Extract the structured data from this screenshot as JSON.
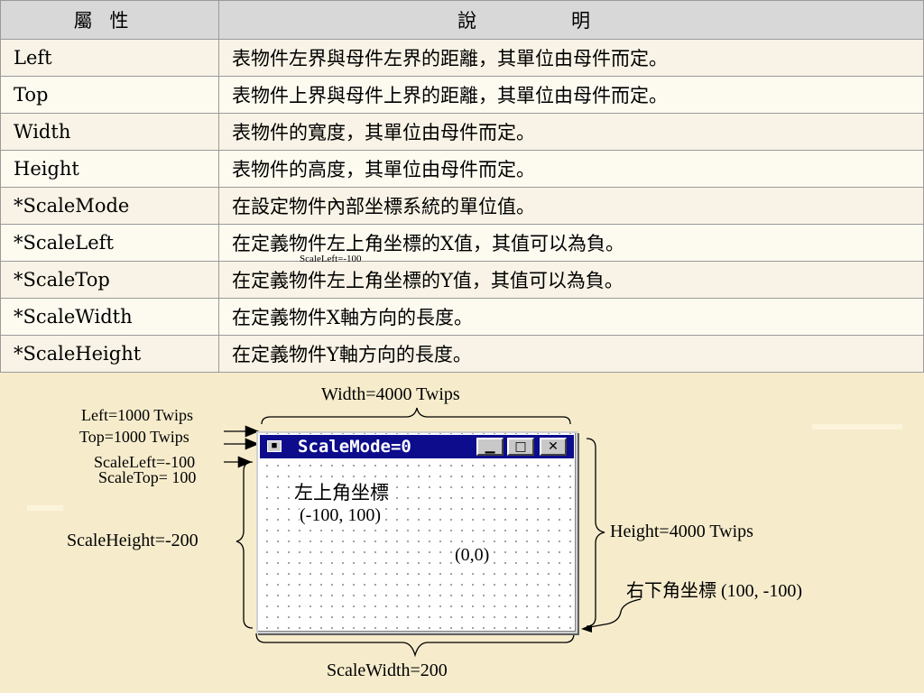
{
  "table": {
    "header_attr": "屬性",
    "header_desc": "說明",
    "rows": [
      {
        "attr": "Left",
        "desc": "表物件左界與母件左界的距離，其單位由母件而定。"
      },
      {
        "attr": "Top",
        "desc": "表物件上界與母件上界的距離，其單位由母件而定。"
      },
      {
        "attr": "Width",
        "desc": "表物件的寬度，其單位由母件而定。"
      },
      {
        "attr": "Height",
        "desc": "表物件的高度，其單位由母件而定。"
      },
      {
        "attr": "*ScaleMode",
        "desc": "在設定物件內部坐標系統的單位值。"
      },
      {
        "attr": "*ScaleLeft",
        "desc": "在定義物件左上角坐標的X值，其值可以為負。"
      },
      {
        "attr": "*ScaleTop",
        "desc": "在定義物件左上角坐標的Y值，其值可以為負。"
      },
      {
        "attr": "*ScaleWidth",
        "desc": "在定義物件X軸方向的長度。"
      },
      {
        "attr": "*ScaleHeight",
        "desc": "在定義物件Y軸方向的長度。"
      }
    ],
    "overlay_note": "ScaleLeft=-100"
  },
  "diagram": {
    "width_label": "Width=4000 Twips",
    "left_label": "Left=1000 Twips",
    "top_label": "Top=1000 Twips",
    "scaleleft_label": "ScaleLeft=-100",
    "scaletop_label": "ScaleTop= 100",
    "scaleheight_label": "ScaleHeight=-200",
    "height_label": "Height=4000 Twips",
    "scalewidth_label": "ScaleWidth=200",
    "topleft_coord_title": "左上角坐標",
    "topleft_coord_value": "(-100, 100)",
    "origin_label": "(0,0)",
    "bottomright_label": "右下角坐標 (100, -100)",
    "window": {
      "caption": "ScaleMode=0",
      "minimize_glyph": "▁",
      "maximize_glyph": "□",
      "close_glyph": "✕",
      "system_menu_glyph": "■"
    }
  }
}
